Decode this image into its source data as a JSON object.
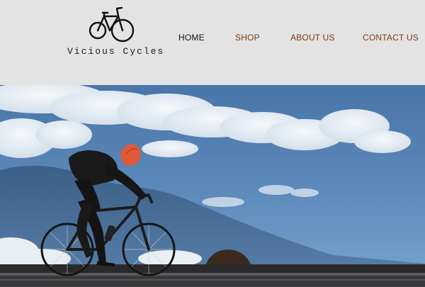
{
  "brand": {
    "name": "Vicious Cycles",
    "icon": "bicycle-icon"
  },
  "nav": {
    "items": [
      {
        "label": "HOME",
        "active": true
      },
      {
        "label": "SHOP",
        "active": false
      },
      {
        "label": "ABOUT US",
        "active": false
      },
      {
        "label": "CONTACT US",
        "active": false
      }
    ]
  },
  "colors": {
    "header_bg": "#e3e3e3",
    "nav_active": "#111111",
    "nav_link": "#7a3a14",
    "sky": "#5886b7"
  },
  "hero": {
    "image": "cyclist-silhouette-on-road-under-cloudy-sky"
  }
}
